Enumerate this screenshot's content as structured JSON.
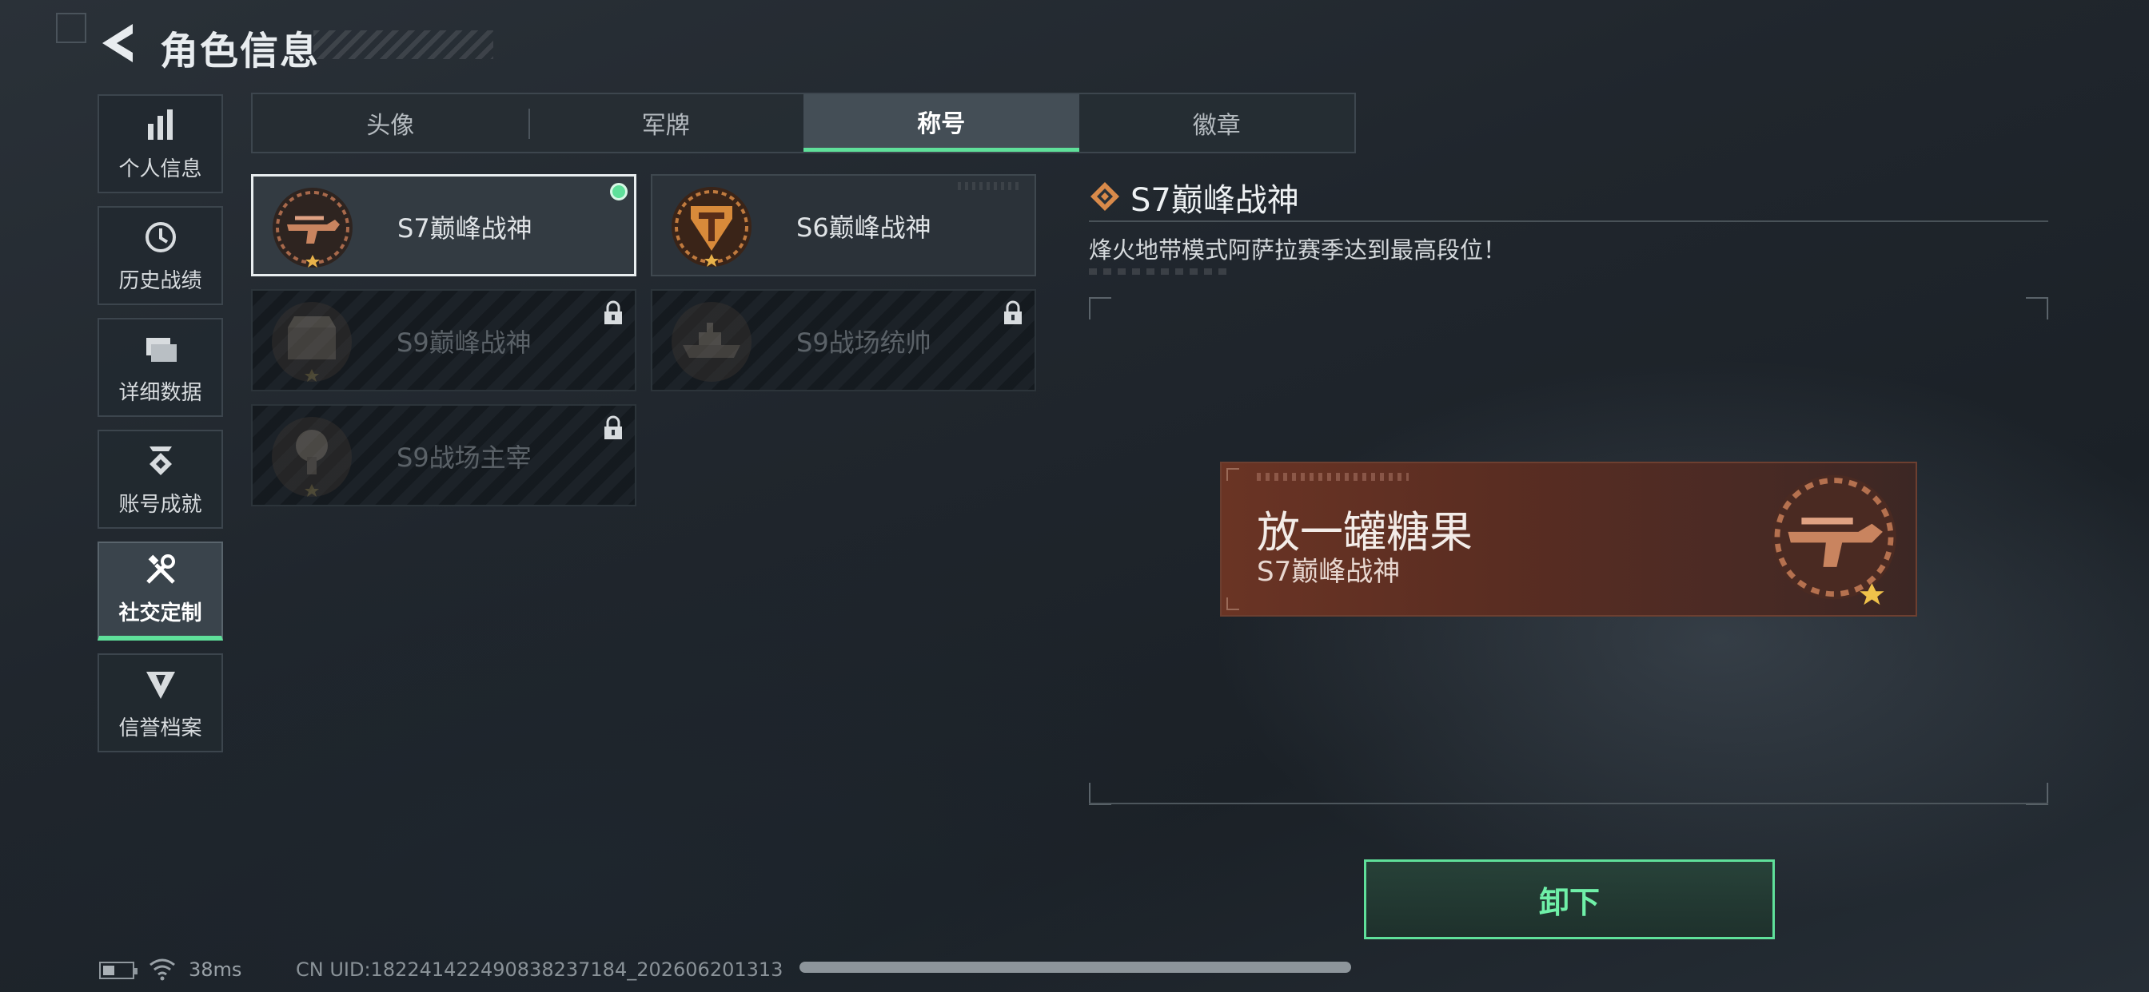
{
  "header": {
    "title": "角色信息"
  },
  "sidebar": {
    "items": [
      {
        "label": "个人信息",
        "icon": "bar-chart-icon"
      },
      {
        "label": "历史战绩",
        "icon": "history-clock-icon"
      },
      {
        "label": "详细数据",
        "icon": "folder-icon"
      },
      {
        "label": "账号成就",
        "icon": "achievement-badge-icon"
      },
      {
        "label": "社交定制",
        "icon": "tools-icon",
        "active": true
      },
      {
        "label": "信誉档案",
        "icon": "shield-emblem-icon"
      }
    ]
  },
  "tabs": [
    {
      "label": "头像"
    },
    {
      "label": "军牌"
    },
    {
      "label": "称号",
      "active": true
    },
    {
      "label": "徽章"
    }
  ],
  "titles": [
    {
      "name": "S7巅峰战神",
      "state": "selected",
      "equipped": true
    },
    {
      "name": "S6巅峰战神",
      "state": "unlocked"
    },
    {
      "name": "S9巅峰战神",
      "state": "locked"
    },
    {
      "name": "S9战场统帅",
      "state": "locked"
    },
    {
      "name": "S9战场主宰",
      "state": "locked"
    }
  ],
  "detail": {
    "title": "S7巅峰战神",
    "description": "烽火地带模式阿萨拉赛季达到最高段位！",
    "preview": {
      "player_name": "放一罐糖果",
      "title": "S7巅峰战神"
    },
    "unequip_label": "卸下"
  },
  "status": {
    "ping": "38ms",
    "uid": "CN UID:18224142249083823718­4_20260620131­3"
  },
  "colors": {
    "accent": "#5fe09a",
    "banner": "#6a3424",
    "bronze": "#b5714f"
  }
}
